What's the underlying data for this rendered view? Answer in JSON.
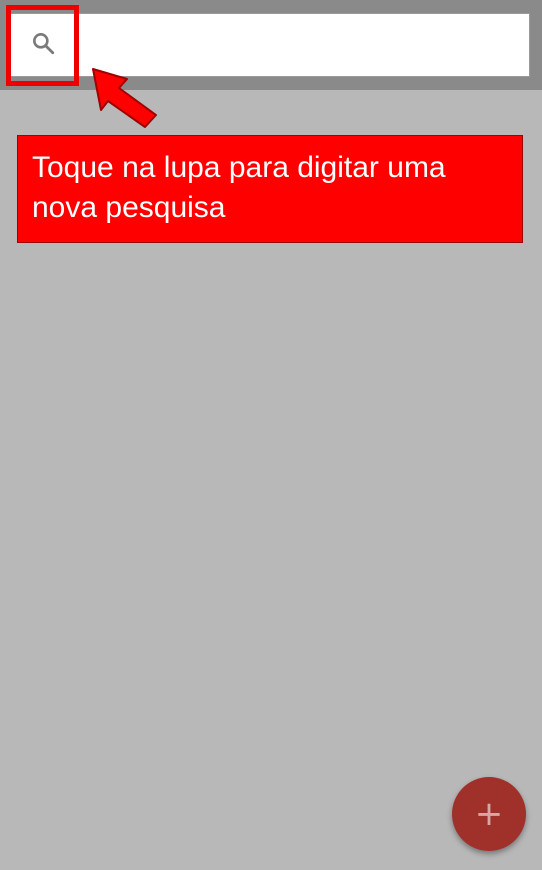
{
  "search": {
    "value": "",
    "placeholder": "",
    "icon": "search-icon"
  },
  "annotation": {
    "text": "Toque na lupa para digitar uma nova pesquisa",
    "color": "#ff0000",
    "arrow_icon": "arrow-icon"
  },
  "fab": {
    "label": "+",
    "icon": "plus-icon",
    "color": "#a0302a"
  },
  "colors": {
    "background": "#b8b8b8",
    "top_bar": "#8a8a8a",
    "highlight": "#ee0000"
  }
}
